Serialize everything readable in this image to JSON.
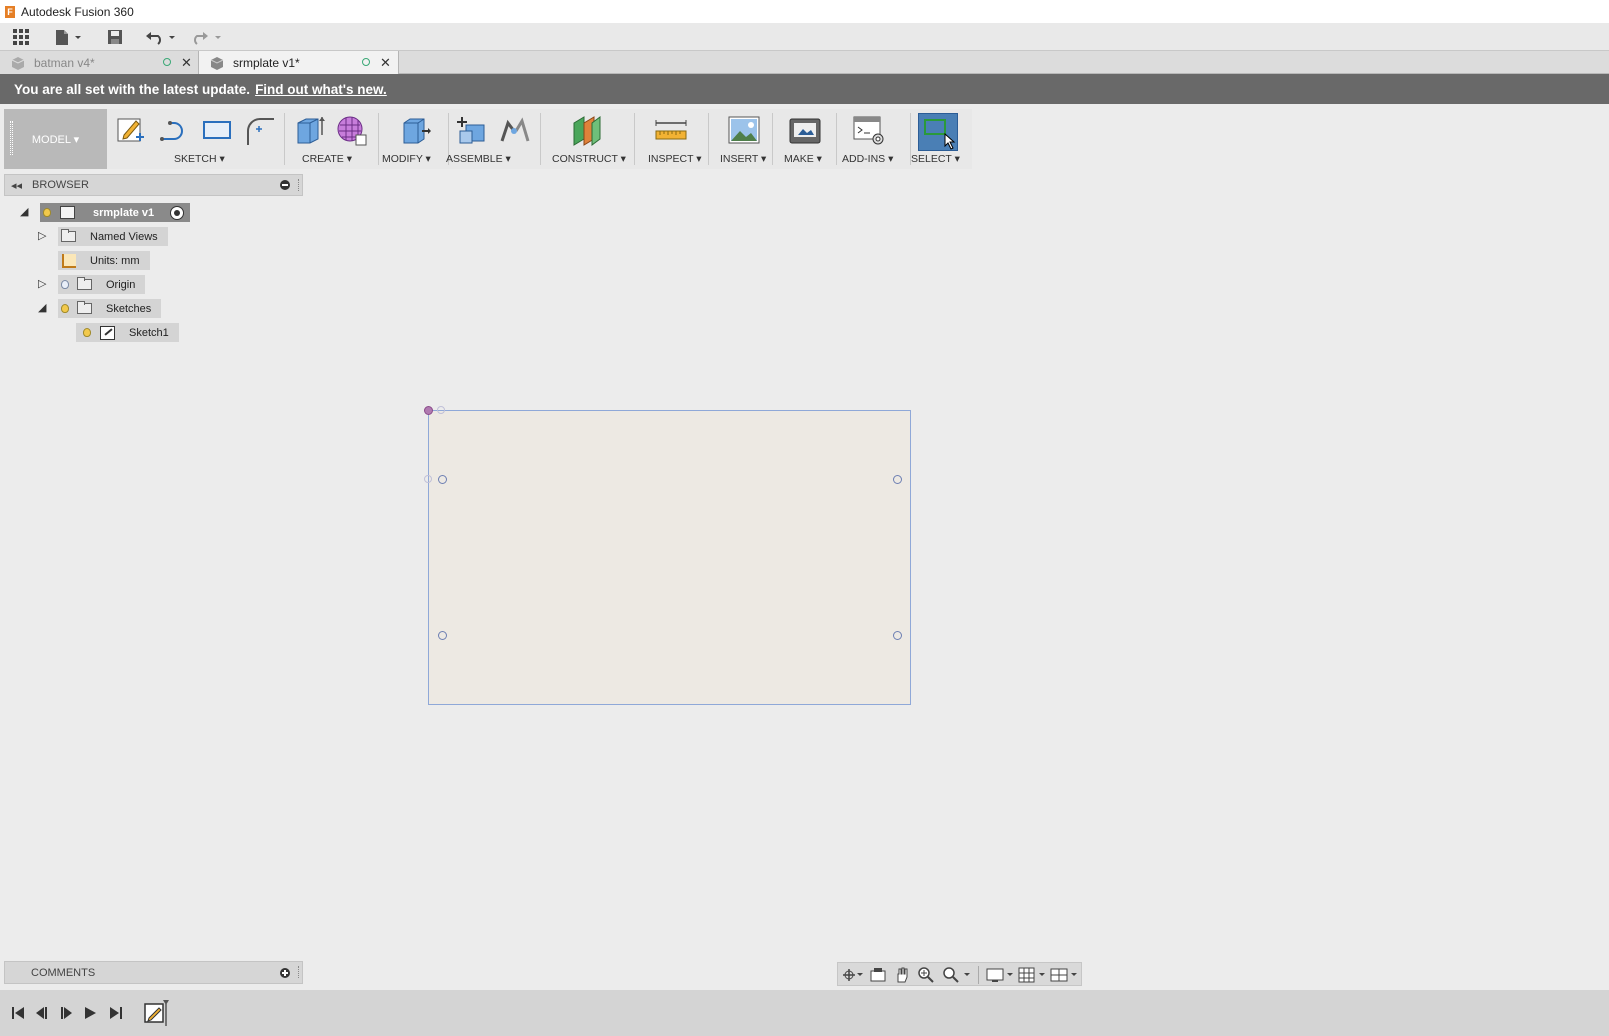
{
  "app": {
    "title": "Autodesk Fusion 360"
  },
  "tabs": [
    {
      "label": "batman v4*",
      "active": false
    },
    {
      "label": "srmplate v1*",
      "active": true
    }
  ],
  "banner": {
    "text": "You are all set with the latest update.",
    "link": "Find out what's new."
  },
  "ribbon": {
    "workspace": "MODEL ▾",
    "groups": [
      {
        "label": "SKETCH ▾"
      },
      {
        "label": "CREATE ▾"
      },
      {
        "label": "MODIFY ▾"
      },
      {
        "label": "ASSEMBLE ▾"
      },
      {
        "label": "CONSTRUCT ▾"
      },
      {
        "label": "INSPECT ▾"
      },
      {
        "label": "INSERT ▾"
      },
      {
        "label": "MAKE ▾"
      },
      {
        "label": "ADD-INS ▾"
      },
      {
        "label": "SELECT ▾"
      }
    ]
  },
  "browser": {
    "title": "BROWSER",
    "root": "srmplate v1",
    "items": [
      {
        "label": "Named Views"
      },
      {
        "label": "Units: mm"
      },
      {
        "label": "Origin"
      },
      {
        "label": "Sketches"
      },
      {
        "label": "Sketch1"
      }
    ]
  },
  "comments": {
    "title": "COMMENTS"
  },
  "colors": {
    "banner": "#696969",
    "select_active": "#4a7fb5",
    "sketch_fill": "#ede9e3",
    "sketch_outline": "#8fa8d8"
  }
}
